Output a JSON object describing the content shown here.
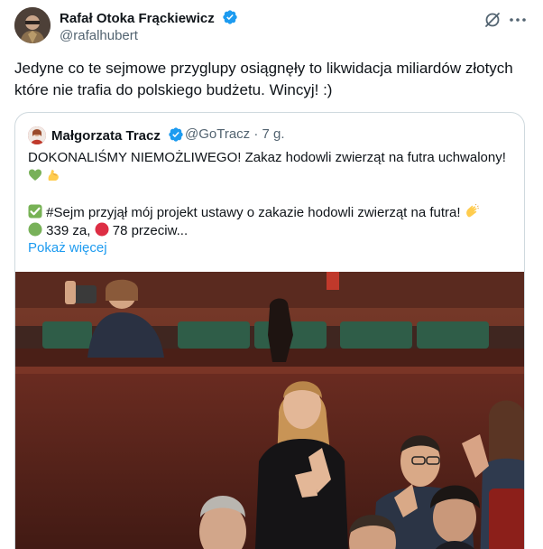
{
  "post": {
    "author_name": "Rafał Otoka Frąckiewicz",
    "author_handle": "@rafalhubert",
    "text": "Jedyne co te sejmowe przyglupy osiągnęły to likwidacja miliardów złotych które nie trafia do polskiego budżetu. Wincyj! :)",
    "icons": {
      "verified": "verified-badge-icon",
      "grok": "grok-icon",
      "more": "more-icon"
    },
    "colors": {
      "verified": "#1d9bf0",
      "link": "#1d9bf0",
      "muted": "#536471",
      "border": "#cfd9de"
    }
  },
  "quote": {
    "author_name": "Małgorzata Tracz",
    "author_handle": "@GoTracz · 7 g.",
    "line1": "DOKONALIŚMY NIEMOŻLIWEGO! Zakaz hodowli zwierząt na futra uchwalony!",
    "line3_text": "#Sejm przyjął mój projekt ustawy o zakazie hodowli zwierząt na futra!",
    "line4_for": "339 za,",
    "line4_against": "78 przeciw...",
    "show_more": "Pokaż więcej",
    "photo": "parliament-photo"
  }
}
